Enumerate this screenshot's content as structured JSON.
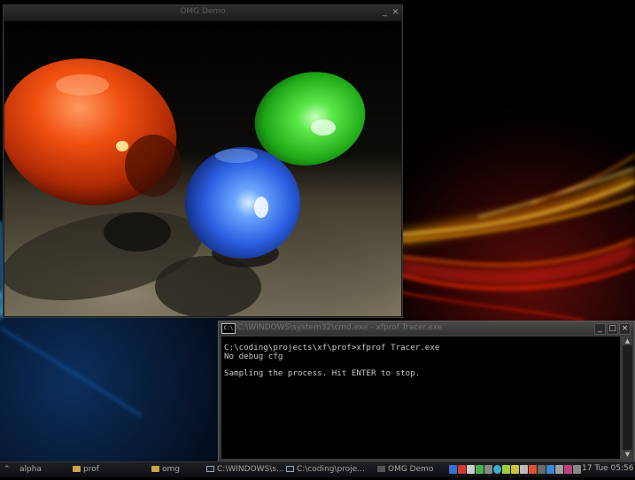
{
  "omg_window": {
    "title": "OMG Demo",
    "minimize_glyph": "_",
    "close_glyph": "×"
  },
  "console": {
    "icon_label": "C:\\",
    "title": "C:\\WINDOWS\\system32\\cmd.exe - xfprof Tracer.exe",
    "lines": [
      "C:\\coding\\projects\\xf\\prof>xfprof Tracer.exe",
      "No debug cfg",
      "",
      "Sampling the process. Hit ENTER to stop."
    ],
    "buttons": {
      "minimize": "_",
      "maximize": "□",
      "close": "×"
    }
  },
  "taskbar": {
    "start_glyph": "⌃",
    "tasks": [
      {
        "label": "alpha",
        "icon": "none"
      },
      {
        "label": "prof",
        "icon": "folder-icon"
      },
      {
        "label": "omg",
        "icon": "folder-icon"
      },
      {
        "label": "C:\\WINDOWS\\s...",
        "icon": "console-icon"
      },
      {
        "label": "C:\\coding\\proje...",
        "icon": "console-icon"
      },
      {
        "label": "OMG Demo",
        "icon": "app-icon"
      }
    ],
    "clock": "17 Tue 05:56"
  },
  "colors": {
    "red_sphere": "#ff5a1a",
    "green_sphere": "#34d42a",
    "blue_sphere": "#3a80f0",
    "desktop_orange": "#ffb300",
    "desktop_red": "#e0201a",
    "desktop_blue": "#1a9ae8"
  }
}
